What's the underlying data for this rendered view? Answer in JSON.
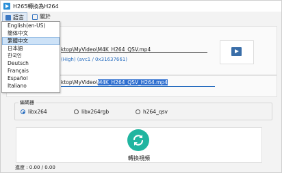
{
  "window": {
    "title": "H265轉換為H264"
  },
  "menu": {
    "language": "語言",
    "about": "關於"
  },
  "language_menu": {
    "items": [
      "English(en-US)",
      "簡体中文",
      "繁體中文",
      "日本語",
      "한국인",
      "Deutsch",
      "Français",
      "Español",
      "Italiano"
    ],
    "highlighted_index": 2
  },
  "input": {
    "path_suffix": "ktop\\MyVideo\\M4K_H264_QSV.mp4",
    "codec_info": "(High) (avc1 / 0x31637661)"
  },
  "output": {
    "path_prefix": "ktop\\MyVideo\\",
    "path_selected": "M4K_H264_QSV_H264.mp4"
  },
  "encoder": {
    "label": "編碼器",
    "options": [
      {
        "label": "libx264",
        "selected": true
      },
      {
        "label": "libx264rgb",
        "selected": false
      },
      {
        "label": "h264_qsv",
        "selected": false
      }
    ]
  },
  "convert_button": {
    "label": "轉換視頻",
    "icon": "refresh-icon",
    "color": "#20b5a0"
  },
  "status": {
    "progress_text": "進度 : 0.00 / 0.00"
  }
}
